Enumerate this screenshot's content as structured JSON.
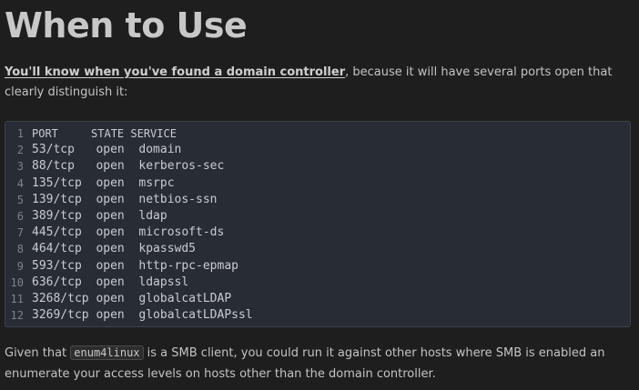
{
  "heading": "When to Use",
  "intro": {
    "link_text": "You'll know when you've found a domain controller",
    "rest_text": ", because it will have several ports open that clearly distinguish it:"
  },
  "code": {
    "lines": [
      {
        "num": "1",
        "text": "PORT     STATE SERVICE"
      },
      {
        "num": "2",
        "text": "53/tcp   open  domain"
      },
      {
        "num": "3",
        "text": "88/tcp   open  kerberos-sec"
      },
      {
        "num": "4",
        "text": "135/tcp  open  msrpc"
      },
      {
        "num": "5",
        "text": "139/tcp  open  netbios-ssn"
      },
      {
        "num": "6",
        "text": "389/tcp  open  ldap"
      },
      {
        "num": "7",
        "text": "445/tcp  open  microsoft-ds"
      },
      {
        "num": "8",
        "text": "464/tcp  open  kpasswd5"
      },
      {
        "num": "9",
        "text": "593/tcp  open  http-rpc-epmap"
      },
      {
        "num": "10",
        "text": "636/tcp  open  ldapssl"
      },
      {
        "num": "11",
        "text": "3268/tcp open  globalcatLDAP"
      },
      {
        "num": "12",
        "text": "3269/tcp open  globalcatLDAPssl"
      }
    ]
  },
  "outro": {
    "before": "Given that ",
    "code": "enum4linux",
    "after": " is a SMB client, you could run it against other hosts where SMB is enabled an enumerate your access levels on hosts other than the domain controller."
  }
}
